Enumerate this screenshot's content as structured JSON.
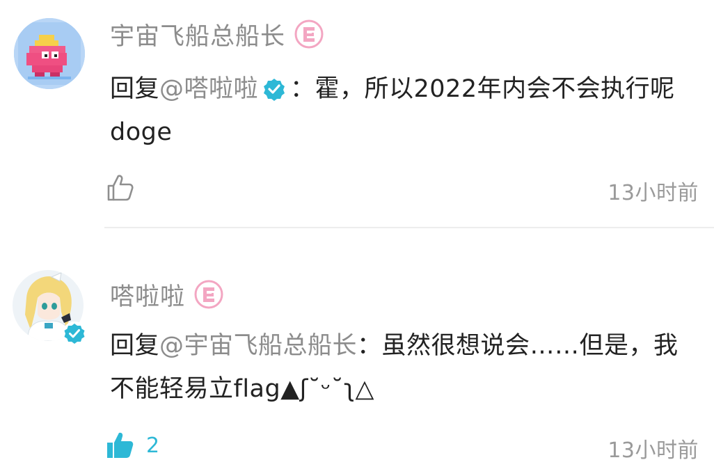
{
  "comments": [
    {
      "username": "宇宙飞船总船长",
      "level_badge_icon": "level-badge-icon",
      "reply_prefix": "回复",
      "mention": "@嗒啦啦",
      "mention_verified_icon": "verified-icon",
      "content": "：霍，所以2022年内会不会执行呢doge",
      "like_count": "",
      "time": "13小时前",
      "liked": false
    },
    {
      "username": "嗒啦啦",
      "level_badge_icon": "level-badge-icon",
      "avatar_verified_icon": "verified-icon",
      "reply_prefix": "回复",
      "mention": "@宇宙飞船总船长",
      "content": "：虽然很想说会……但是，我不能轻易立flag▲ʃ˘ᵕ˘ʅ△",
      "like_count": "2",
      "time": "13小时前",
      "liked": true
    }
  ],
  "colors": {
    "accent": "#2db8d6",
    "badge_pink": "#f3a6c2",
    "username_gray": "#8c8c8c",
    "divider": "#ededed"
  }
}
